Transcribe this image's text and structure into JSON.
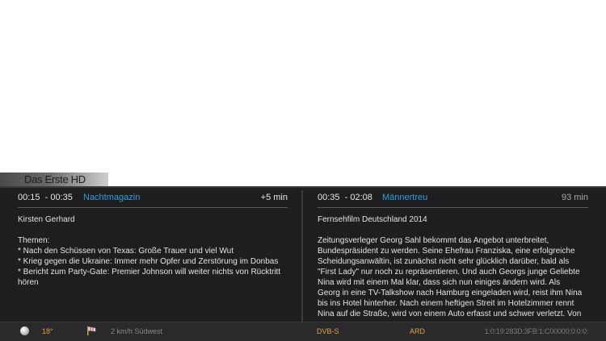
{
  "channel": {
    "name": "Das Erste HD"
  },
  "now": {
    "time": "00:15  - 00:35",
    "title": "Nachtmagazin",
    "remaining": "+5 min",
    "description_lines": [
      "Kirsten Gerhard",
      "",
      "Themen:",
      "* Nach den Schüssen von Texas: Große Trauer und viel Wut",
      "* Krieg gegen die Ukraine: Immer mehr Opfer und Zerstörung im Donbas",
      "* Bericht zum Party-Gate: Premier Johnson will weiter nichts von Rücktritt",
      "hören"
    ]
  },
  "next": {
    "time": "00:35  - 02:08",
    "title": "Männertreu",
    "duration": "93 min",
    "description_lines": [
      "Fernsehfilm Deutschland 2014",
      "",
      "Zeitungsverleger Georg Sahl bekommt das Angebot unterbreitet,",
      "Bundespräsident zu werden. Seine Ehefrau Franziska, eine erfolgreiche",
      "Scheidungsanwältin, ist zunächst nicht sehr glücklich darüber, bald als",
      "\"First Lady\" nur noch zu repräsentieren. Und auch Georgs junge Geliebte",
      "Nina wird mit einem Mal klar, dass sich nun einiges ändern wird. Als",
      "Georg in eine TV-Talkshow nach Hamburg eingeladen wird, reist ihm Nina",
      "bis ins Hotel hinterher. Nach einem heftigen Streit im Hotelzimmer rennt",
      "Nina auf die Straße, wird von einem Auto erfasst und schwer verletzt. Von"
    ]
  },
  "status": {
    "weather_icon": "moon-icon",
    "temperature": "18°",
    "wind_icon": "wind-icon",
    "wind": "2 km/h Südwest",
    "tuner": "DVB-S",
    "provider": "ARD",
    "service_ref": "1:0:19:283D:3FB:1:C00000:0:0:0:"
  },
  "colors": {
    "accent_title": "#2f9ee0",
    "status_orange": "#e7a13a",
    "panel_bg": "#1e1e20"
  }
}
